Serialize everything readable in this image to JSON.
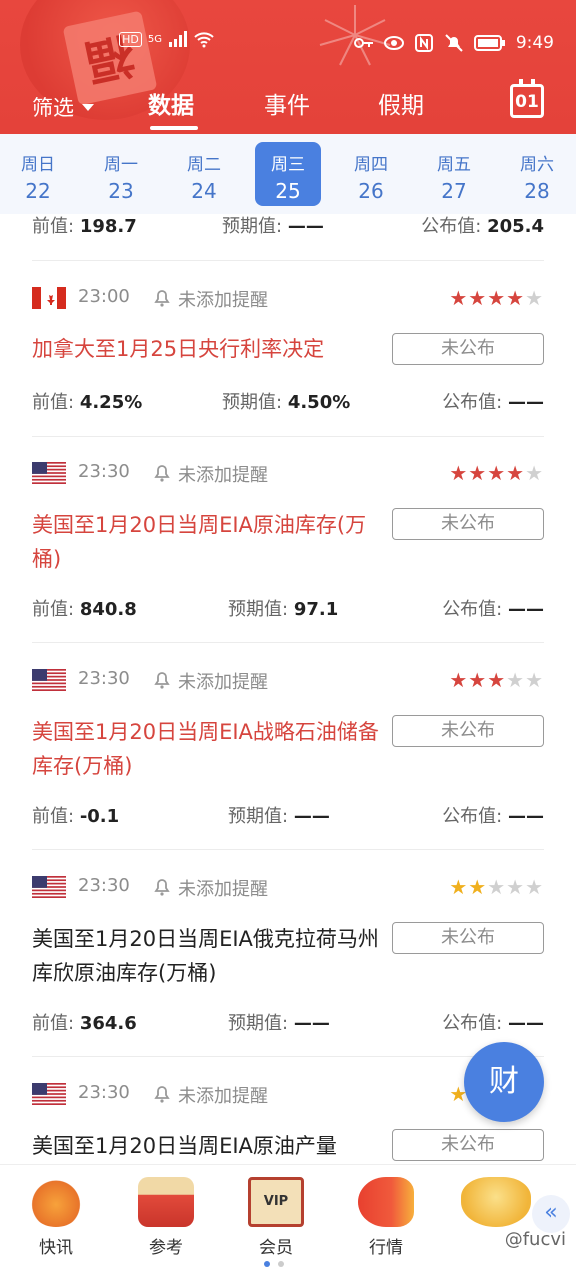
{
  "status_bar": {
    "time": "9:49",
    "left_icons": [
      "HD",
      "5G"
    ]
  },
  "nav": {
    "filter_label": "筛选",
    "tabs": [
      {
        "label": "数据",
        "active": true
      },
      {
        "label": "事件",
        "active": false
      },
      {
        "label": "假期",
        "active": false
      }
    ],
    "calendar_day": "01"
  },
  "week": [
    {
      "weekday": "周日",
      "date": "22"
    },
    {
      "weekday": "周一",
      "date": "23"
    },
    {
      "weekday": "周二",
      "date": "24"
    },
    {
      "weekday": "周三",
      "date": "25",
      "active": true
    },
    {
      "weekday": "周四",
      "date": "26"
    },
    {
      "weekday": "周五",
      "date": "27"
    },
    {
      "weekday": "周六",
      "date": "28"
    }
  ],
  "labels": {
    "prev": "前值:",
    "expected": "预期值:",
    "published": "公布值:",
    "reminder": "未添加提醒",
    "unpublished": "未公布"
  },
  "top_row": {
    "prev": "198.7",
    "expected": "——",
    "published": "205.4"
  },
  "events": [
    {
      "flag": "ca",
      "time": "23:00",
      "stars": 4,
      "star_color": "#d6453e",
      "title": "加拿大至1月25日央行利率决定",
      "title_color": "red",
      "prev": "4.25%",
      "expected": "4.50%",
      "published": "——"
    },
    {
      "flag": "us",
      "time": "23:30",
      "stars": 4,
      "star_color": "#d6453e",
      "title": "美国至1月20日当周EIA原油库存(万桶)",
      "title_color": "red",
      "prev": "840.8",
      "expected": "97.1",
      "published": "——"
    },
    {
      "flag": "us",
      "time": "23:30",
      "stars": 3,
      "star_color": "#d6453e",
      "title": "美国至1月20日当周EIA战略石油储备库存(万桶)",
      "title_color": "red",
      "prev": "-0.1",
      "expected": "——",
      "published": "——"
    },
    {
      "flag": "us",
      "time": "23:30",
      "stars": 2,
      "star_color": "#f0b01e",
      "title": "美国至1月20日当周EIA俄克拉荷马州库欣原油库存(万桶)",
      "title_color": "dark",
      "prev": "364.6",
      "expected": "——",
      "published": "——"
    },
    {
      "flag": "us",
      "time": "23:30",
      "stars": 2,
      "star_color": "#f0b01e",
      "title": "美国至1月20日当周EIA原油产量",
      "title_color": "dark"
    }
  ],
  "fab_label": "财",
  "bottom_nav": [
    {
      "label": "快讯",
      "icon": "tiger-icon"
    },
    {
      "label": "参考",
      "icon": "drum-icon"
    },
    {
      "label": "会员",
      "icon": "vip-scroll-icon"
    },
    {
      "label": "行情",
      "icon": "fish-icon"
    },
    {
      "label": "",
      "icon": "gold-ingot-icon"
    }
  ],
  "watermark": "@fucvi"
}
